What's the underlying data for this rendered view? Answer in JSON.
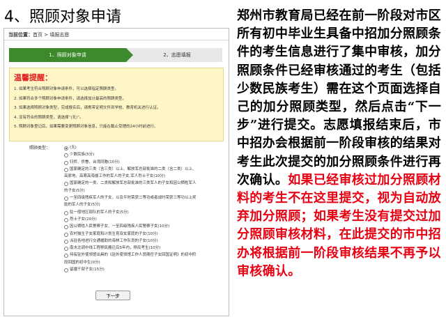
{
  "slide": {
    "title": "4、照顾对象申请",
    "paragraph_black": "郑州市教育局已经在前一阶段对市区所有初中毕业生具备中招加分照顾条件的考生信息进行了集中审核，加分照顾条件已经审核通过的考生（包括少数民族考生）需在这个页面选择自己的加分照顾类型，然后点击“下一步”进行提交。志愿填报结束后，市中招办会根据前一阶段审核的结果对考生此次提交的加分照顾条件进行再次确认。",
    "paragraph_red": "如果已经审核过加分照顾材料的考生不在这里提交，视为自动放弃加分照顾；如果考生没有提交过加分照顾审核材料，在此提交的市中招办将根据前一阶段审核结果不再予以审核确认。"
  },
  "screenshot": {
    "breadcrumb": {
      "label": "当前位置：",
      "path": "首页 > 填报志愿"
    },
    "steps": [
      "1、照顾对象申请",
      "2、志愿填报"
    ],
    "notice": {
      "title": "温馨提醒：",
      "items": [
        "1. 如果考生符合照顾对象申请条件，可以选择指定照顾类型。",
        "2. 如果符合多个照顾对象申请条件，请选择加分最高的照顾类型。",
        "3. 如果选择照顾对象类型，完成报名后，请携带证明文件到学校、教育机关进行认证。",
        "4. 没有符合的照顾类型，请选择“(无)”。",
        "5. 照顾对象登记后，如果需要变更照顾对象信息，只能在截止受理的24小时前进行。"
      ]
    },
    "type_label": "照顾类型：",
    "options": [
      {
        "text": "(无)",
        "radio": true,
        "checked": true
      },
      {
        "text": "少数民族(5分)",
        "radio": true
      },
      {
        "text": "归侨、侨眷、台湾同胞(10分)",
        "radio": true
      },
      {
        "text": "国家确定的三类（含三类）以上、解放军总部批准的二类（含二类）以上、",
        "radio": true
      },
      {
        "text": "高原地、高寒高海拔工作的军人的子女,军人烈士子女(10分)",
        "radio": false
      },
      {
        "text": "国家确定的一类、二类和解放军总部批准的三类军人的子女和因公牺牲军人",
        "radio": true
      },
      {
        "text": "的子女(5分)",
        "radio": false
      },
      {
        "text": "一至四级残疾军人的子女，以及平时荣获二等功或者战时荣获三等功以上奖",
        "radio": true
      },
      {
        "text": "励的军人的子女(5分)",
        "radio": false
      },
      {
        "text": "驻一般地区部队的军人的子女(5分)",
        "radio": true
      },
      {
        "text": "烈士子女(20分)",
        "radio": true
      },
      {
        "text": "因公牺牲人民警察子女、一至四级残疾人民警察子女(10分)",
        "radio": true
      },
      {
        "text": "农村独生子女家庭和计划生育双女家庭的子女(10分)",
        "radio": true
      },
      {
        "text": "派驻各地进行交通援助的海林工作队员的子女(10分)",
        "radio": true
      },
      {
        "text": "南水北调中线工程移民搬迁后5年内，移民考生(10分)",
        "radio": true
      },
      {
        "text": "持有驻外使领馆出具的《驻外使领馆工作人员随任子女回国证明》的初中阶",
        "radio": true
      },
      {
        "text": "段回国的初中生(0分)",
        "radio": false
      },
      {
        "text": "留疆干部子女(15分)",
        "radio": true
      }
    ],
    "next_button": "下一步"
  }
}
